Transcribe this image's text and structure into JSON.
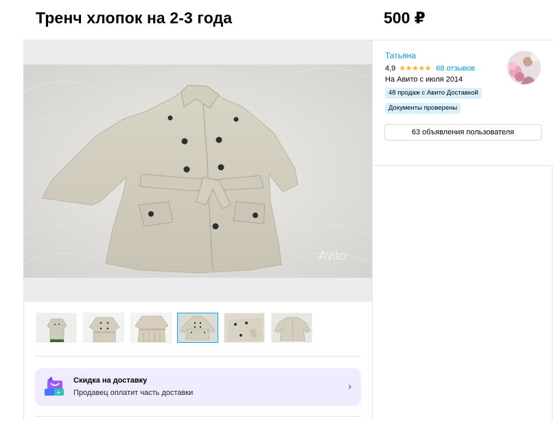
{
  "listing": {
    "title": "Тренч хлопок на 2-3 года",
    "price": "500 ₽"
  },
  "gallery": {
    "main_photo": "beige-trench-coat-photo",
    "watermark": "Avito",
    "thumbnails": [
      {
        "icon": "thumb-coat-1"
      },
      {
        "icon": "thumb-coat-2"
      },
      {
        "icon": "thumb-coat-3"
      },
      {
        "icon": "thumb-coat-4",
        "active": true
      },
      {
        "icon": "thumb-coat-5"
      },
      {
        "icon": "thumb-coat-6"
      }
    ]
  },
  "promo": {
    "title": "Скидка на доставку",
    "subtitle": "Продавец оплатит часть доставки",
    "icon": "delivery-discount-icon",
    "chevron": "›"
  },
  "seller": {
    "name": "Татьяна",
    "rating": "4,9",
    "stars": "★★★★★",
    "reviews": "68 отзывов",
    "since": "На Авито с июля 2014",
    "badges": [
      "48 продаж с Авито Доставкой",
      "Документы проверены"
    ],
    "listings_button": "63 объявления пользователя"
  },
  "colors": {
    "link": "#0099dd",
    "star": "#ffb021",
    "badge_bg": "#d9f1ff",
    "promo_bg": "#f0ebff",
    "active_thumb_border": "#00aaff"
  }
}
